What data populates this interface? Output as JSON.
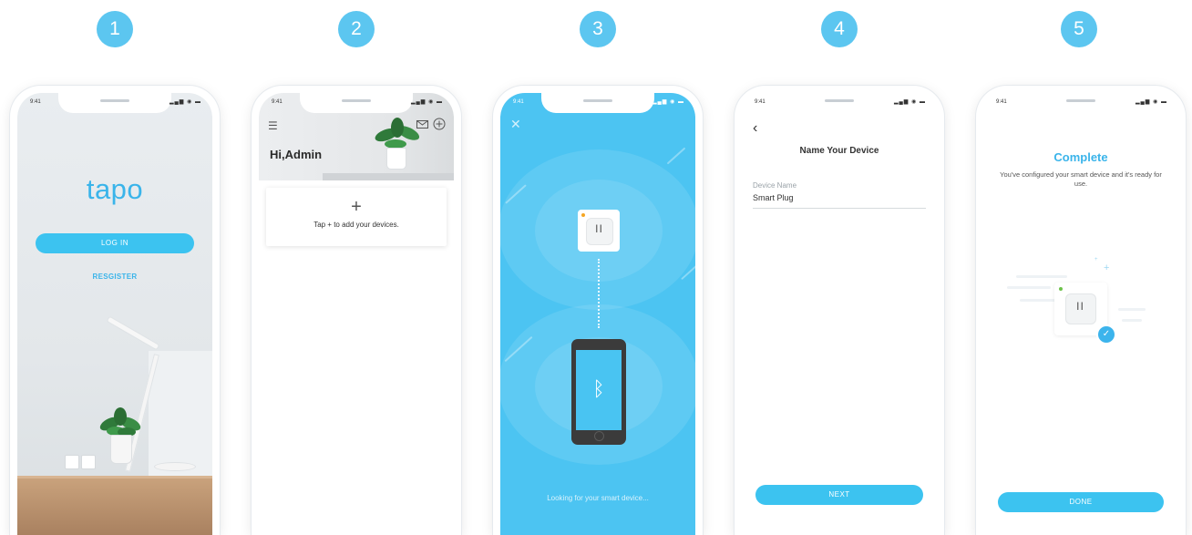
{
  "steps": [
    "1",
    "2",
    "3",
    "4",
    "5"
  ],
  "status_bar": {
    "time": "9:41",
    "icons": "▂▄▆ ◉ ▬"
  },
  "screen1": {
    "logo": "tapo",
    "login_label": "LOG IN",
    "register_label": "RESGISTER"
  },
  "screen2": {
    "greeting": "Hi,Admin",
    "add_symbol": "+",
    "add_hint": "Tap + to add your devices."
  },
  "screen3": {
    "status_text": "Looking for your smart device..."
  },
  "screen4": {
    "title": "Name Your Device",
    "field_label": "Device Name",
    "field_value": "Smart Plug",
    "next_label": "NEXT"
  },
  "screen5": {
    "title": "Complete",
    "description": "You've configured your smart device and it's ready for use.",
    "done_label": "DONE"
  },
  "colors": {
    "accent": "#3cc3f0",
    "step_badge": "#5cc6f0",
    "blue_screen": "#4cc4f2"
  }
}
